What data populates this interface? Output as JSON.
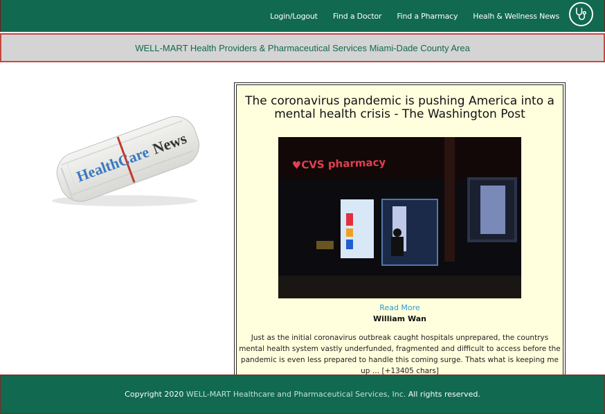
{
  "nav": {
    "links": [
      "Login/Logout",
      "Find a Doctor",
      "Find a Pharmacy",
      "Healh & Wellness News"
    ],
    "logo_icon": "stethoscope-icon"
  },
  "banner": {
    "text": "WELL-MART Health Providers & Pharmaceutical Services Miami-Dade County Area"
  },
  "sidebar": {
    "image_icon": "newspaper-icon",
    "image_text": "HealthCare News"
  },
  "article": {
    "title": "The coronavirus pandemic is pushing America into a mental health crisis - The Washington Post",
    "image_sign_text": "CVS pharmacy",
    "read_more": "Read More",
    "author": "William Wan",
    "summary": "Just as the initial coronavirus outbreak caught hospitals unprepared, the countrys mental health system vastly underfunded, fragmented and difficult to access before the pandemic is even less prepared to handle this coming surge. Thats what is keeping me up … [+13405 chars]"
  },
  "footer": {
    "prefix": "Copyright 2020",
    "company": "WELL-MART Healthcare and Pharmaceutical Services, Inc.",
    "suffix": "All rights reserved."
  },
  "colors": {
    "brand_green": "#11694f",
    "banner_gray": "#d4d4d4",
    "article_bg": "#ffffdd",
    "link_blue": "#2a9bd8"
  }
}
